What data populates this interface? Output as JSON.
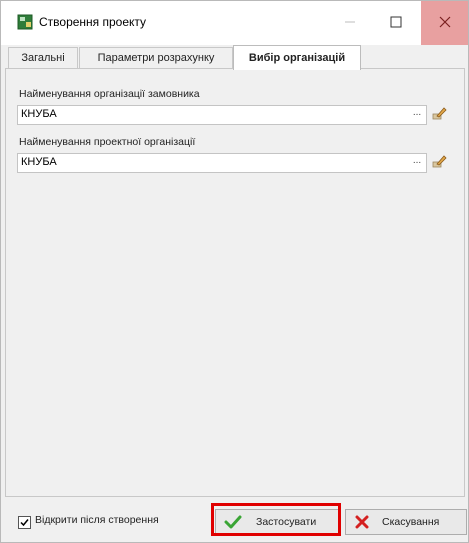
{
  "window": {
    "title": "Створення проекту"
  },
  "tabs": [
    {
      "label": "Загальні"
    },
    {
      "label": "Параметри розрахунку"
    },
    {
      "label": "Вибір організацій"
    }
  ],
  "customer_org": {
    "label": "Найменування організації замовника",
    "value": "КНУБА"
  },
  "design_org": {
    "label": "Найменування проектної організації",
    "value": "КНУБА"
  },
  "open_after": {
    "label": "Відкрити після створення",
    "checked": true
  },
  "buttons": {
    "apply": "Застосувати",
    "cancel": "Скасування",
    "ellipsis": "..."
  },
  "colors": {
    "highlight": "#e00000",
    "apply_icon": "#3aa535",
    "cancel_icon": "#d42020"
  }
}
